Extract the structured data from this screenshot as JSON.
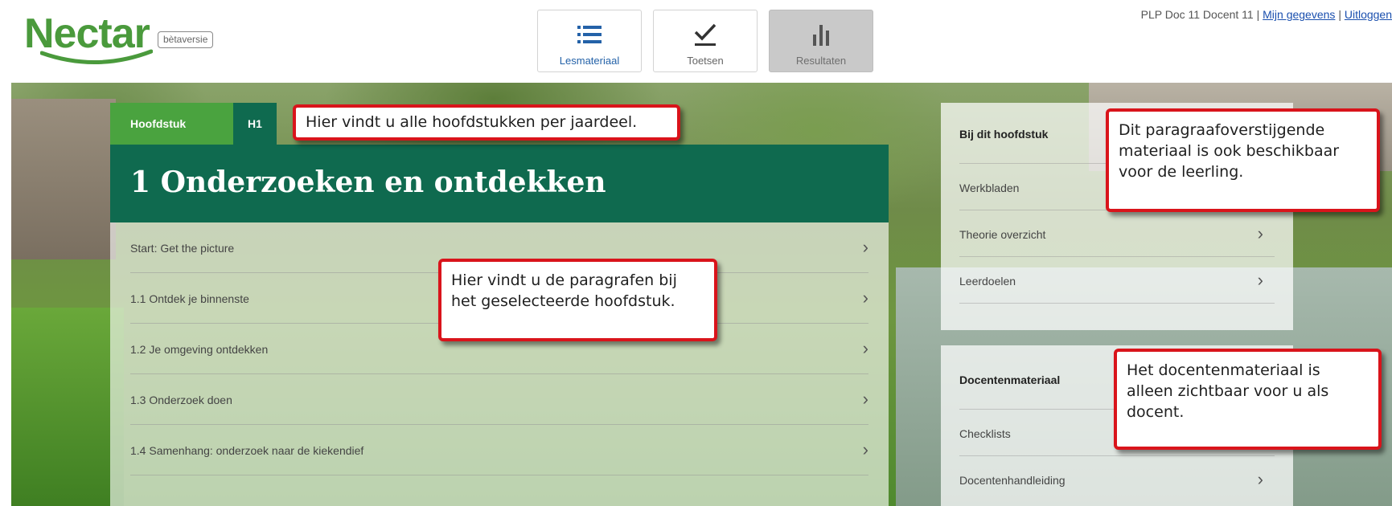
{
  "header": {
    "logo_text": "Nectar",
    "beta_label": "bètaversie",
    "user_text": "PLP Doc 11 Docent 11",
    "separator": "|",
    "my_details_link": "Mijn gegevens",
    "logout_link": "Uitloggen"
  },
  "tabs": [
    {
      "label": "Lesmateriaal",
      "icon": "list-icon",
      "state": "active"
    },
    {
      "label": "Toetsen",
      "icon": "checkmark-icon",
      "state": "normal"
    },
    {
      "label": "Resultaten",
      "icon": "bar-chart-icon",
      "state": "disabled"
    }
  ],
  "chapter": {
    "tab_label": "Hoofdstuk",
    "tab_value": "H1",
    "title": "1 Onderzoeken en ontdekken",
    "paragraphs": [
      "Start: Get the picture",
      "1.1 Ontdek je binnenste",
      "1.2 Je omgeving ontdekken",
      "1.3 Onderzoek doen",
      "1.4 Samenhang: onderzoek naar de kiekendief"
    ]
  },
  "side": {
    "chapter_heading": "Bij dit hoofdstuk",
    "chapter_items": [
      "Werkbladen",
      "Theorie overzicht",
      "Leerdoelen"
    ],
    "teacher_heading": "Docentenmateriaal",
    "teacher_items": [
      "Checklists",
      "Docentenhandleiding"
    ]
  },
  "callouts": {
    "chapters": "Hier vindt u alle hoofdstukken per jaardeel.",
    "paragraphs": "Hier vindt u de paragrafen bij het geselecteerde hoofdstuk.",
    "student_material": "Dit paragraafoverstijgende materiaal is ook beschikbaar voor de leerling.",
    "teacher_material": "Het docentenmateriaal is alleen zichtbaar voor u als docent."
  },
  "colors": {
    "brand_green": "#4a9a3c",
    "header_dark_green": "#0f6a4f",
    "callout_red": "#d9141b",
    "link_blue": "#1a4fae"
  }
}
